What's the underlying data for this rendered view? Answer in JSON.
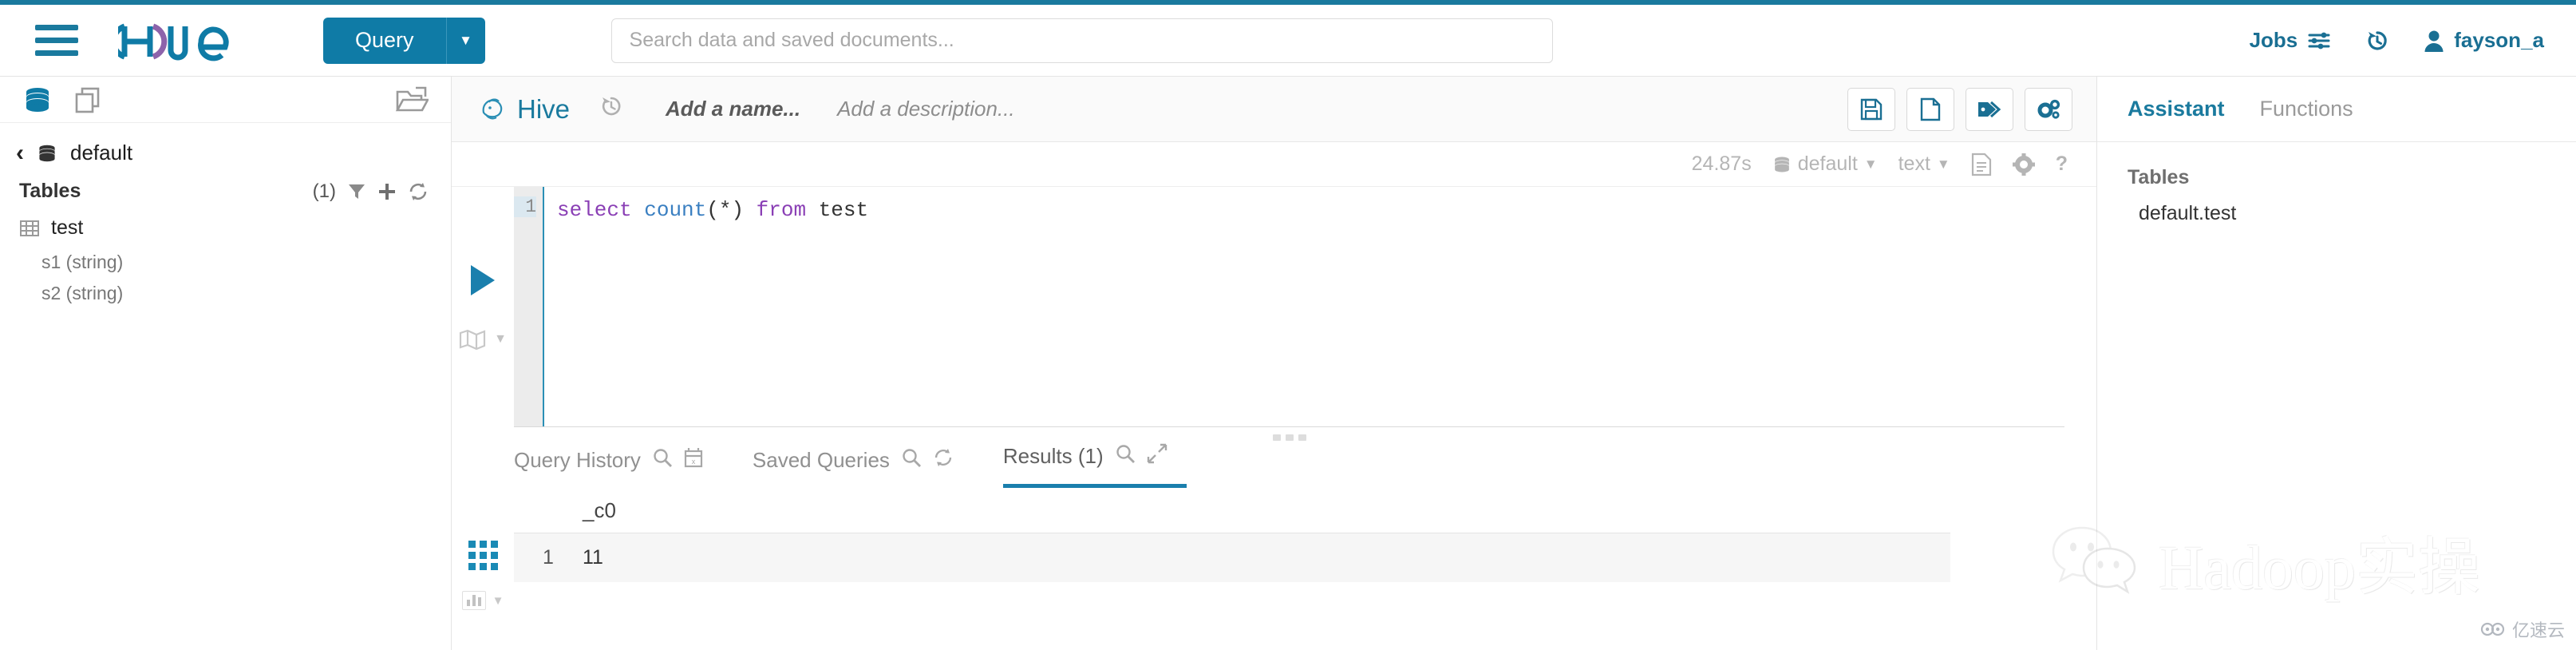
{
  "app": {
    "brand": "hue",
    "accent_color": "#1a7a9e",
    "button_color": "#0f7ba6"
  },
  "header": {
    "menu_icon": "hamburger-icon",
    "logo_text": "hue",
    "query_button": {
      "label": "Query",
      "caret_icon": "chevron-down-icon"
    },
    "search": {
      "placeholder": "Search data and saved documents...",
      "value": ""
    },
    "jobs": {
      "label": "Jobs",
      "icon": "sliders-icon"
    },
    "history_icon": "history-icon",
    "user": {
      "name": "fayson_a",
      "icon": "user-icon"
    }
  },
  "sidebar": {
    "toolbar": {
      "sources_icon": "database-icon",
      "documents_icon": "documents-icon",
      "import_icon": "folder-open-icon"
    },
    "breadcrumb": {
      "back_icon": "chevron-left-icon",
      "db_icon": "database-icon",
      "database": "default"
    },
    "tables_header": {
      "label": "Tables",
      "count": "(1)",
      "filter_icon": "filter-icon",
      "add_icon": "plus-icon",
      "refresh_icon": "refresh-icon"
    },
    "tables": [
      {
        "name": "test",
        "icon": "table-icon",
        "columns": [
          "s1 (string)",
          "s2 (string)"
        ]
      }
    ]
  },
  "editor": {
    "engine": {
      "name": "Hive",
      "icon": "hive-icon"
    },
    "history_icon": "history-icon",
    "name_placeholder": "Add a name...",
    "description_placeholder": "Add a description...",
    "actions": [
      {
        "name": "save-button",
        "icon": "save-icon"
      },
      {
        "name": "new-document-button",
        "icon": "file-icon"
      },
      {
        "name": "tags-button",
        "icon": "tags-icon"
      },
      {
        "name": "settings-button",
        "icon": "gears-icon"
      }
    ],
    "settings": {
      "duration": "24.87s",
      "database": {
        "label": "default",
        "icon": "database-icon",
        "caret": "chevron-down-icon"
      },
      "format": {
        "label": "text",
        "caret": "chevron-down-icon"
      },
      "log_icon": "file-lines-icon",
      "gear_icon": "gear-icon",
      "help_icon": "question-icon"
    },
    "run_icon": "play-icon",
    "explain_icon": "map-icon",
    "explain_caret": "chevron-down-icon",
    "code": {
      "line_number": "1",
      "tokens": [
        {
          "text": "select",
          "type": "keyword"
        },
        {
          "text": " ",
          "type": "plain"
        },
        {
          "text": "count",
          "type": "function"
        },
        {
          "text": "(*) ",
          "type": "plain"
        },
        {
          "text": "from",
          "type": "keyword"
        },
        {
          "text": " test",
          "type": "plain"
        }
      ],
      "full_text": "select count(*) from test"
    }
  },
  "results": {
    "tabs": [
      {
        "label": "Query History",
        "active": false,
        "icons": [
          "search-icon",
          "calendar-clear-icon"
        ]
      },
      {
        "label": "Saved Queries",
        "active": false,
        "icons": [
          "search-icon",
          "refresh-icon"
        ]
      },
      {
        "label": "Results (1)",
        "active": true,
        "icons": [
          "search-icon",
          "expand-icon"
        ]
      }
    ],
    "view_icons": [
      {
        "name": "grid-view-icon",
        "active": true
      },
      {
        "name": "chart-view-icon",
        "active": false
      },
      {
        "name": "chart-view-caret-icon",
        "active": false
      }
    ],
    "columns": [
      "_c0"
    ],
    "rows": [
      {
        "index": "1",
        "values": [
          "11"
        ]
      }
    ]
  },
  "assistant": {
    "tabs": [
      {
        "label": "Assistant",
        "active": true
      },
      {
        "label": "Functions",
        "active": false
      }
    ],
    "sections": [
      {
        "title": "Tables",
        "items": [
          "default.test"
        ]
      }
    ]
  },
  "watermark": {
    "text": "Hadoop实操",
    "icon": "wechat-icon"
  },
  "corner_badge": {
    "text": "亿速云",
    "icon": "cloud-icon"
  }
}
